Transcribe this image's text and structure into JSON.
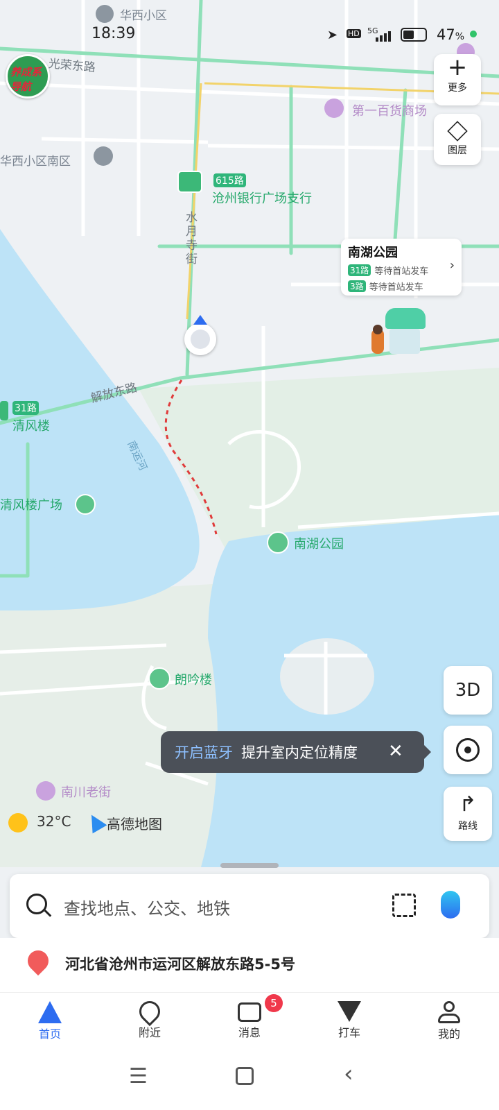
{
  "status_bar": {
    "time": "18:39",
    "battery": "47",
    "network": "5G"
  },
  "app_logo": "养成系导航",
  "map_labels": {
    "huaxi": "华西小区",
    "huaxi_south": "华西小区南区",
    "guangrong_road": "光荣东路",
    "baihuo": "第一百货商场",
    "bus_615": "615路",
    "bank": "沧州银行广场支行",
    "shuiyuesi_street": "水月寺街",
    "jiefang_road": "解放东路",
    "bus_31": "31路",
    "qingfeng": "清风楼",
    "nanyun_river": "南运河",
    "qingfeng_square": "清风楼广场",
    "nanhu_park": "南湖公园",
    "langyin": "朗吟楼",
    "nanchuan": "南川老街",
    "temperature": "32°C",
    "map_brand": "高德地图"
  },
  "bus_card": {
    "title": "南湖公园",
    "routes": [
      {
        "route": "31路",
        "status": "等待首站发车"
      },
      {
        "route": "3路",
        "status": "等待首站发车"
      }
    ]
  },
  "controls": {
    "more": "更多",
    "layers": "图层",
    "three_d": "3D",
    "route": "路线"
  },
  "toast": {
    "highlight": "开启蓝牙",
    "message": "提升室内定位精度"
  },
  "search": {
    "placeholder": "查找地点、公交、地铁"
  },
  "address": "河北省沧州市运河区解放东路5-5号",
  "tabs": [
    {
      "label": "首页"
    },
    {
      "label": "附近"
    },
    {
      "label": "消息",
      "badge": "5"
    },
    {
      "label": "打车"
    },
    {
      "label": "我的"
    }
  ],
  "colors": {
    "accent": "#2d6cf0",
    "road_green": "#8fe0b8",
    "water": "#bde3f7",
    "park": "#e3efe6",
    "badge": "#f0384b"
  }
}
